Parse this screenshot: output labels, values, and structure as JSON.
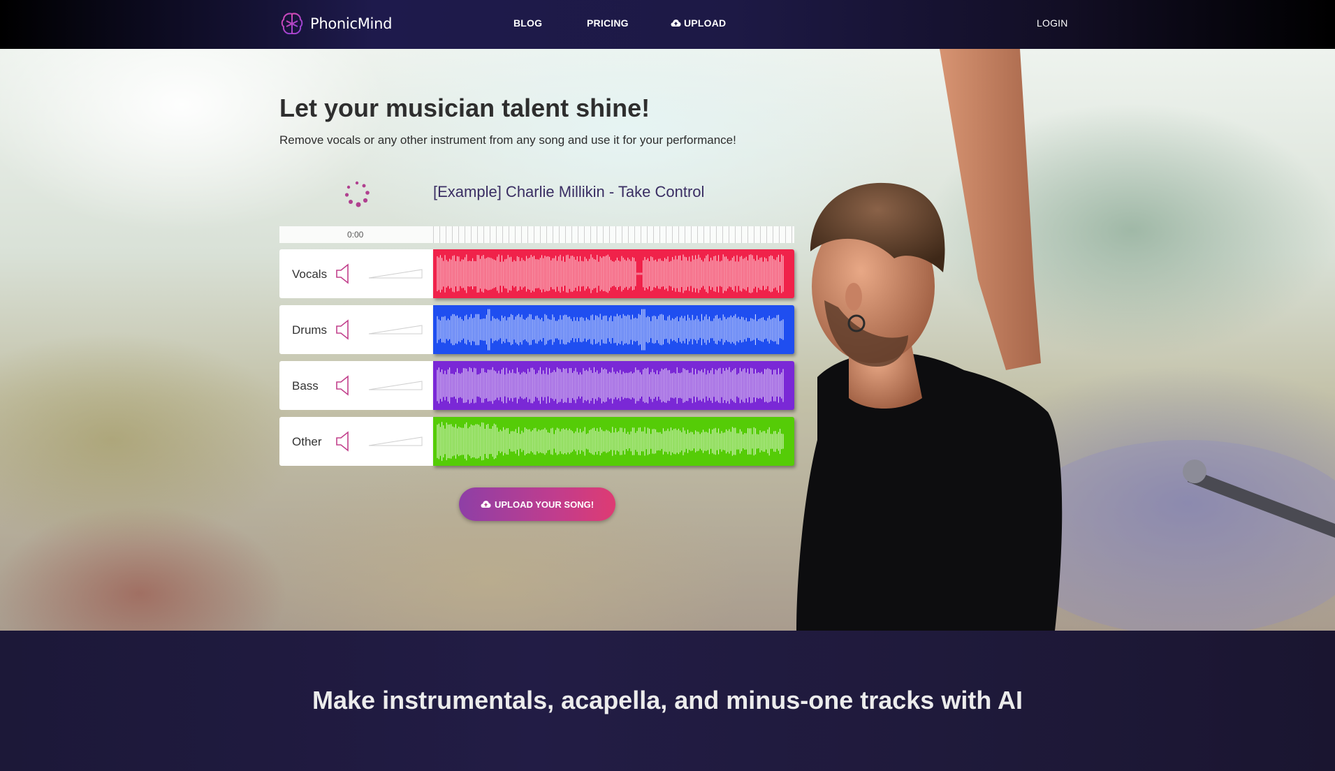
{
  "nav": {
    "brand": "PhonicMind",
    "links": [
      {
        "label": "BLOG"
      },
      {
        "label": "PRICING"
      },
      {
        "label": "UPLOAD",
        "icon": "cloud-upload-icon"
      }
    ],
    "login": "LOGIN"
  },
  "hero": {
    "title": "Let your musician talent shine!",
    "subtitle": "Remove vocals or any other instrument from any song and use it for your performance!"
  },
  "player": {
    "track_title": "[Example] Charlie Millikin - Take Control",
    "current_time": "0:00",
    "status_icon": "loading-spinner-icon",
    "stems": [
      {
        "name": "Vocals",
        "color": "#f0224a",
        "volume_icon": "speaker-icon"
      },
      {
        "name": "Drums",
        "color": "#1f4ef0",
        "volume_icon": "speaker-icon"
      },
      {
        "name": "Bass",
        "color": "#7a28d6",
        "volume_icon": "speaker-icon"
      },
      {
        "name": "Other",
        "color": "#55cc07",
        "volume_icon": "speaker-icon"
      }
    ]
  },
  "cta": {
    "label": "UPLOAD YOUR SONG!",
    "icon": "cloud-upload-icon"
  },
  "section": {
    "title": "Make instrumentals, acapella, and minus-one tracks with AI"
  },
  "colors": {
    "accent": "#c2408c",
    "nav_bg": "#1e1a4c",
    "section_bg": "#1f1a3b"
  }
}
